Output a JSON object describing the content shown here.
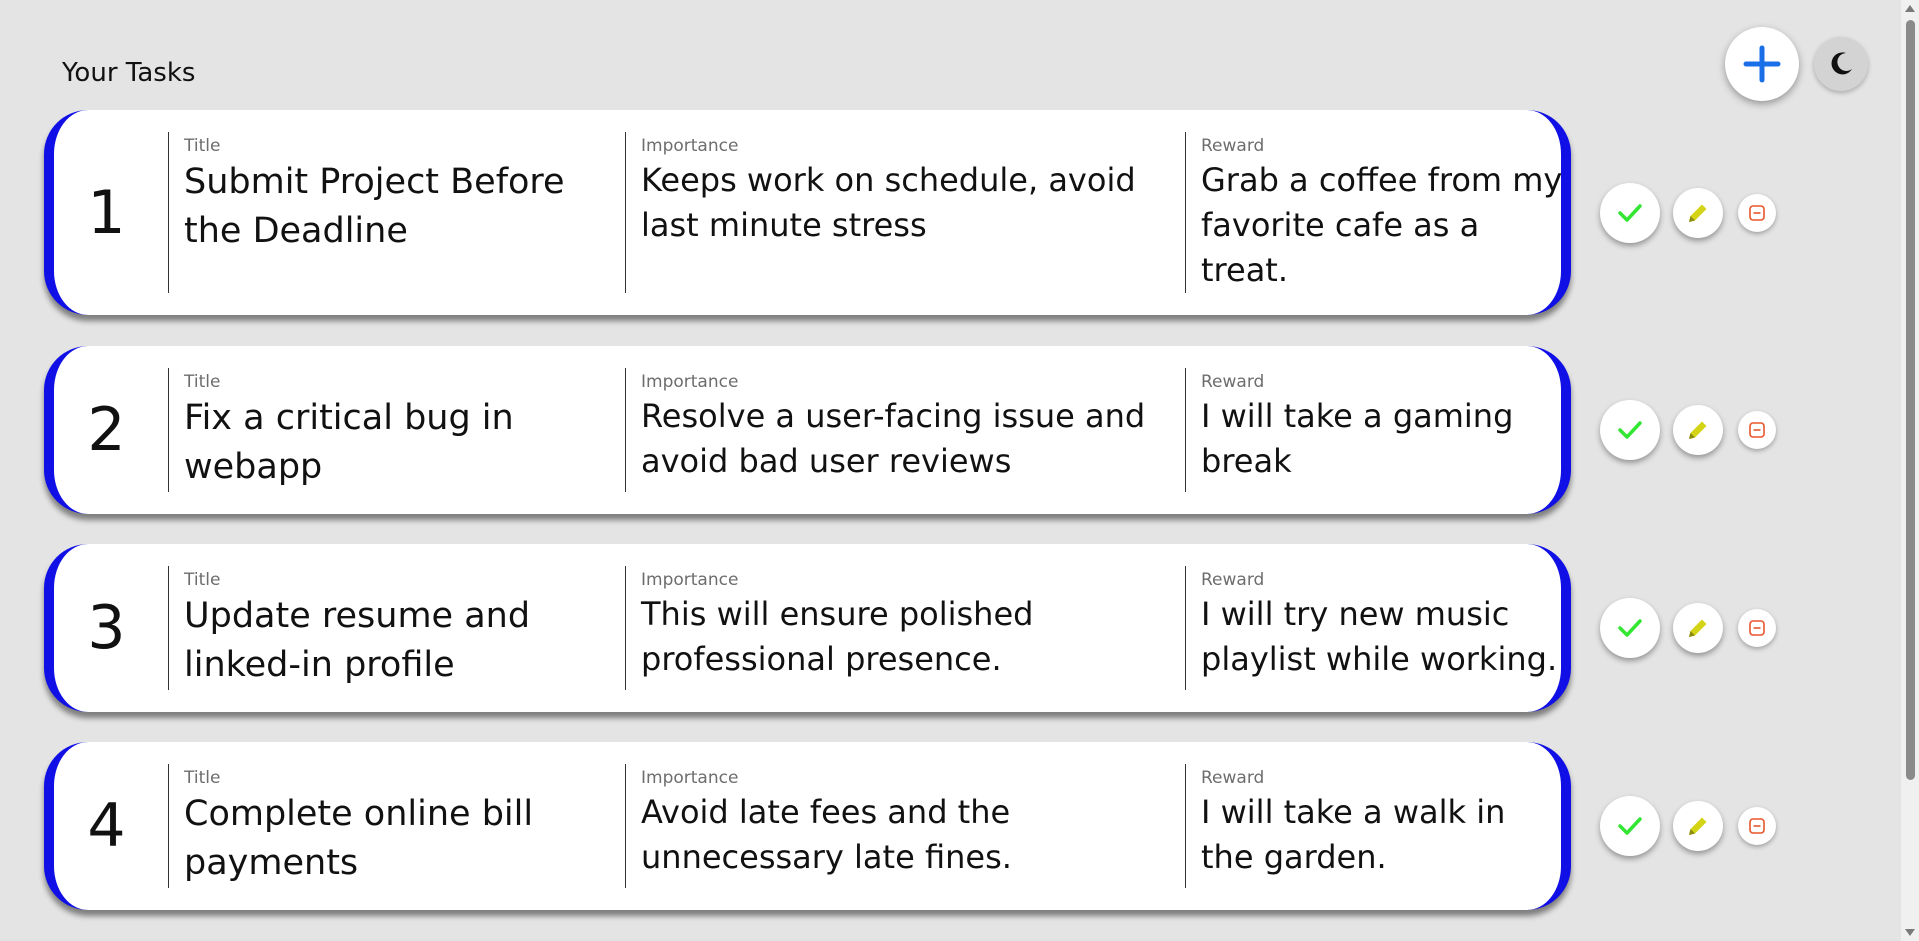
{
  "header": {
    "title": "Your Tasks",
    "add_icon": "plus-icon",
    "theme_icon": "moon-icon"
  },
  "labels": {
    "title": "Title",
    "importance": "Importance",
    "reward": "Reward"
  },
  "colors": {
    "card_border": "#1010e6",
    "complete": "#33e633",
    "edit": "#d4d416",
    "delete": "#e8552a",
    "add": "#1a6ee8"
  },
  "tasks": [
    {
      "number": "1",
      "title": "Submit Project Before the Deadline",
      "importance": "Keeps work on schedule, avoid last minute stress",
      "reward": "Grab a coffee from my favorite cafe as a treat."
    },
    {
      "number": "2",
      "title": "Fix a critical bug in webapp",
      "importance": "Resolve a user-facing issue and avoid bad user reviews",
      "reward": "I will take a gaming break"
    },
    {
      "number": "3",
      "title": "Update resume and linked-in profile",
      "importance": "This will ensure polished professional presence.",
      "reward": "I will try new music playlist while working."
    },
    {
      "number": "4",
      "title": "Complete online bill payments",
      "importance": "Avoid late fees and the unnecessary late fines.",
      "reward": "I will take a walk in the garden."
    }
  ]
}
